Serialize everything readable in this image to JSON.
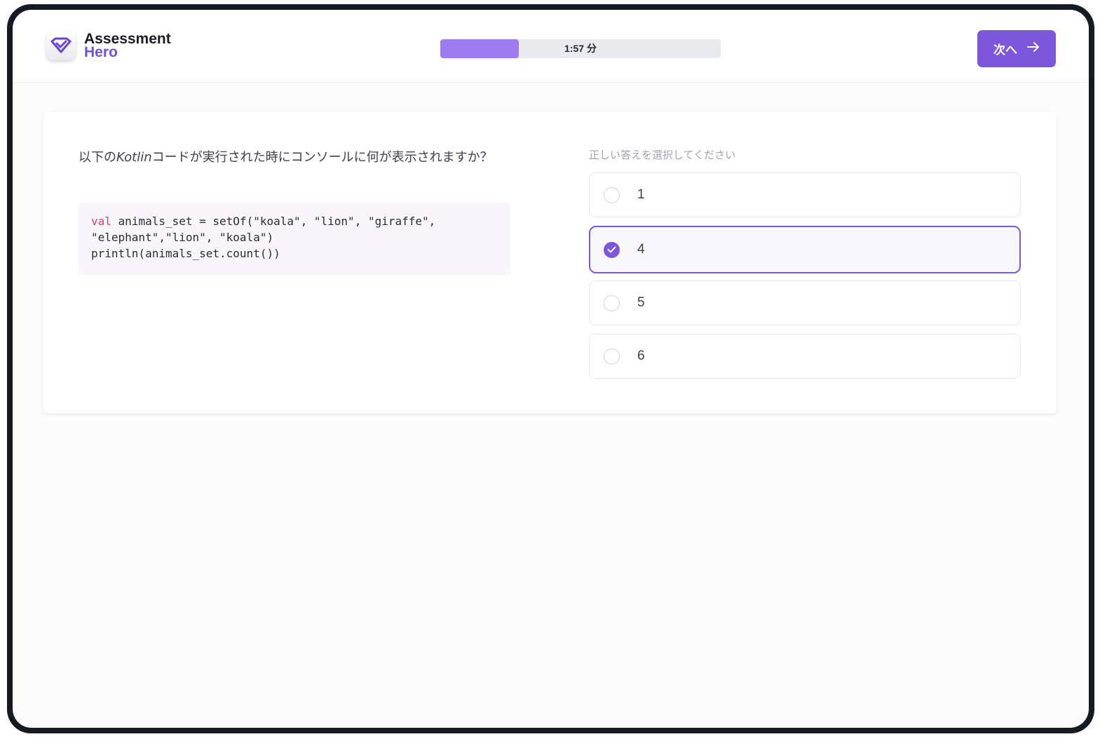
{
  "app": {
    "logo_line1": "Assessment",
    "logo_line2": "Hero",
    "logo_icon": "diamond-check-icon"
  },
  "timer": {
    "label": "1:57 分",
    "progress_fraction": 0.28
  },
  "header": {
    "next_label": "次へ",
    "next_icon": "arrow-right-icon"
  },
  "question": {
    "text_before": "以下の",
    "text_emphasis": "Kotlin",
    "text_after": "コードが実行された時にコンソールに何が表示されますか？",
    "code": {
      "line1_keyword": "val",
      "line1_rest": " animals_set = setOf(\"koala\", \"lion\", \"giraffe\",",
      "line2": "\"elephant\",\"lion\", \"koala\")",
      "line3": "println(animals_set.count())"
    }
  },
  "answers": {
    "prompt": "正しい答えを選択してください",
    "options": [
      {
        "label": "1",
        "selected": false
      },
      {
        "label": "4",
        "selected": true
      },
      {
        "label": "5",
        "selected": false
      },
      {
        "label": "6",
        "selected": false
      }
    ]
  },
  "colors": {
    "accent": "#7c56db",
    "timer_fill": "#9d7cef",
    "code_keyword": "#d2455c",
    "frame": "#151a23"
  }
}
